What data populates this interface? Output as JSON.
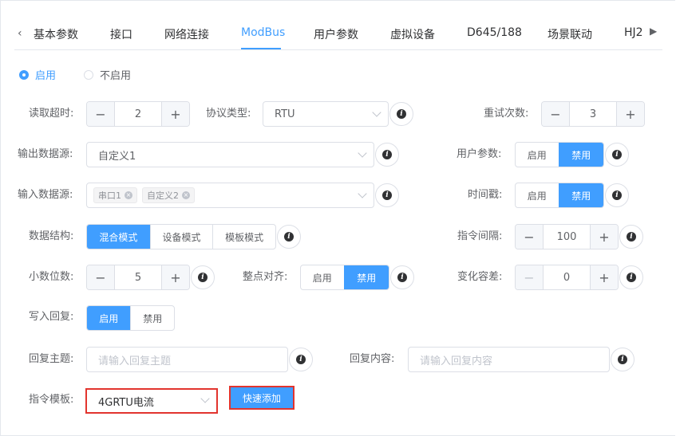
{
  "tabs": {
    "items": [
      "基本参数",
      "接口",
      "网络连接",
      "ModBus",
      "用户参数",
      "虚拟设备",
      "D645/188",
      "场景联动",
      "HJ2"
    ],
    "active": "ModBus"
  },
  "enable": {
    "on_label": "启用",
    "off_label": "不启用",
    "selected": "启用"
  },
  "read_timeout": {
    "label": "读取超时:",
    "value": "2"
  },
  "protocol": {
    "label": "协议类型:",
    "value": "RTU"
  },
  "retry": {
    "label": "重试次数:",
    "value": "3"
  },
  "output_source": {
    "label": "输出数据源:",
    "value": "自定义1"
  },
  "user_params": {
    "label": "用户参数:",
    "enable": "启用",
    "disable": "禁用",
    "selected": "禁用"
  },
  "input_source": {
    "label": "输入数据源:",
    "tags": [
      "串口1",
      "自定义2"
    ]
  },
  "timestamp": {
    "label": "时间戳:",
    "enable": "启用",
    "disable": "禁用",
    "selected": "禁用"
  },
  "data_structure": {
    "label": "数据结构:",
    "options": [
      "混合模式",
      "设备模式",
      "模板模式"
    ],
    "selected": "混合模式"
  },
  "cmd_interval": {
    "label": "指令间隔:",
    "value": "100"
  },
  "decimals": {
    "label": "小数位数:",
    "value": "5"
  },
  "align": {
    "label": "整点对齐:",
    "enable": "启用",
    "disable": "禁用",
    "selected": "禁用"
  },
  "tolerance": {
    "label": "变化容差:",
    "value": "0"
  },
  "write_reply": {
    "label": "写入回复:",
    "enable": "启用",
    "disable": "禁用",
    "selected": "启用"
  },
  "reply_topic": {
    "label": "回复主题:",
    "placeholder": "请输入回复主题"
  },
  "reply_content": {
    "label": "回复内容:",
    "placeholder": "请输入回复内容"
  },
  "cmd_template": {
    "label": "指令模板:",
    "value": "4GRTU电流"
  },
  "quick_add": {
    "label": "快速添加"
  },
  "colors": {
    "primary": "#409eff",
    "highlight": "#e2342e"
  },
  "icons": {
    "info": "info-icon",
    "tab_left": "chevron-left-icon",
    "tab_right": "caret-right-icon"
  }
}
